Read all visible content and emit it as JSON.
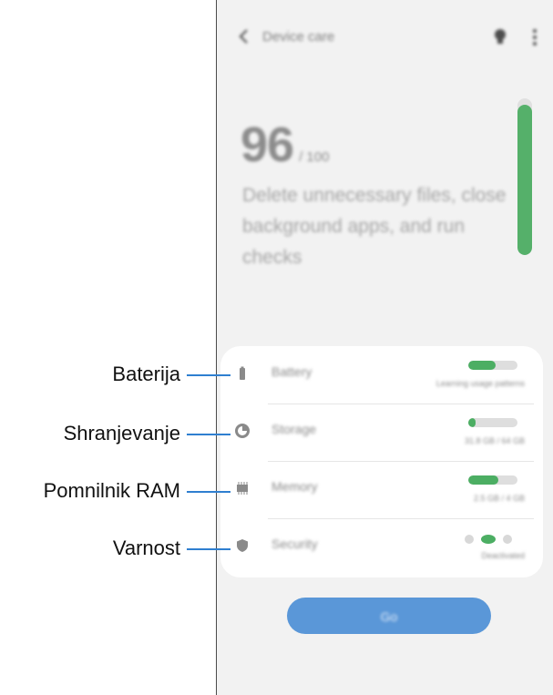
{
  "app": {
    "title": "Device care"
  },
  "score": {
    "value": "96",
    "max": "/ 100"
  },
  "description": "Delete unnecessary files, close background apps, and run checks",
  "gauge_level": 0.96,
  "items": [
    {
      "label": "Battery",
      "icon": "battery-icon",
      "status": "Learning usage patterns",
      "level": 0.55
    },
    {
      "label": "Storage",
      "icon": "storage-icon",
      "status": "31.8 GB / 64 GB",
      "level": 0.15
    },
    {
      "label": "Memory",
      "icon": "memory-chip-icon",
      "status": "2.5 GB / 4 GB",
      "level": 0.62
    },
    {
      "label": "Security",
      "icon": "shield-icon",
      "status": "Deactivated"
    }
  ],
  "action_button": {
    "label": "Go"
  },
  "callouts": [
    "Baterija",
    "Shranjevanje",
    "Pomnilnik RAM",
    "Varnost"
  ],
  "colors": {
    "accent_green": "#4cae63",
    "button_blue": "#5a97d8",
    "callout_line": "#2f7fd0"
  }
}
